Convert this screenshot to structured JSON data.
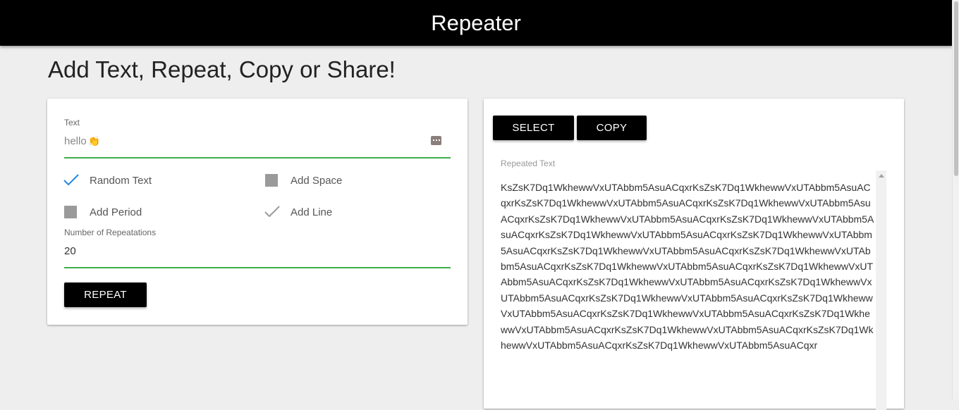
{
  "header": {
    "title": "Repeater"
  },
  "page": {
    "heading": "Add Text, Repeat, Copy or Share!"
  },
  "form": {
    "text_label": "Text",
    "text_value": "hello",
    "text_emoji": "👏",
    "options": [
      {
        "label": "Random Text",
        "checked": true
      },
      {
        "label": "Add Space",
        "checked": false
      },
      {
        "label": "Add Period",
        "checked": false
      },
      {
        "label": "Add Line",
        "checked": true
      }
    ],
    "repetitions_label": "Number of Repeatations",
    "repetitions_value": "20",
    "repeat_button": "REPEAT"
  },
  "output": {
    "select_button": "SELECT",
    "copy_button": "COPY",
    "label": "Repeated Text",
    "text": "KsZsK7Dq1WkhewwVxUTAbbm5AsuACqxrKsZsK7Dq1WkhewwVxUTAbbm5AsuACqxrKsZsK7Dq1WkhewwVxUTAbbm5AsuACqxrKsZsK7Dq1WkhewwVxUTAbbm5AsuACqxrKsZsK7Dq1WkhewwVxUTAbbm5AsuACqxrKsZsK7Dq1WkhewwVxUTAbbm5AsuACqxrKsZsK7Dq1WkhewwVxUTAbbm5AsuACqxrKsZsK7Dq1WkhewwVxUTAbbm5AsuACqxrKsZsK7Dq1WkhewwVxUTAbbm5AsuACqxrKsZsK7Dq1WkhewwVxUTAbbm5AsuACqxrKsZsK7Dq1WkhewwVxUTAbbm5AsuACqxrKsZsK7Dq1WkhewwVxUTAbbm5AsuACqxrKsZsK7Dq1WkhewwVxUTAbbm5AsuACqxrKsZsK7Dq1WkhewwVxUTAbbm5AsuACqxrKsZsK7Dq1WkhewwVxUTAbbm5AsuACqxrKsZsK7Dq1WkhewwVxUTAbbm5AsuACqxrKsZsK7Dq1WkhewwVxUTAbbm5AsuACqxrKsZsK7Dq1WkhewwVxUTAbbm5AsuACqxrKsZsK7Dq1WkhewwVxUTAbbm5AsuACqxrKsZsK7Dq1WkhewwVxUTAbbm5AsuACqxrKsZsK7Dq1WkhewwVxUTAbbm5AsuACqxr"
  },
  "colors": {
    "accent_green": "#3fae49",
    "checkbox_tick_active": "#1e88e5",
    "checkbox_tick_inactive": "#9a9a9a",
    "button_bg": "#000000"
  }
}
